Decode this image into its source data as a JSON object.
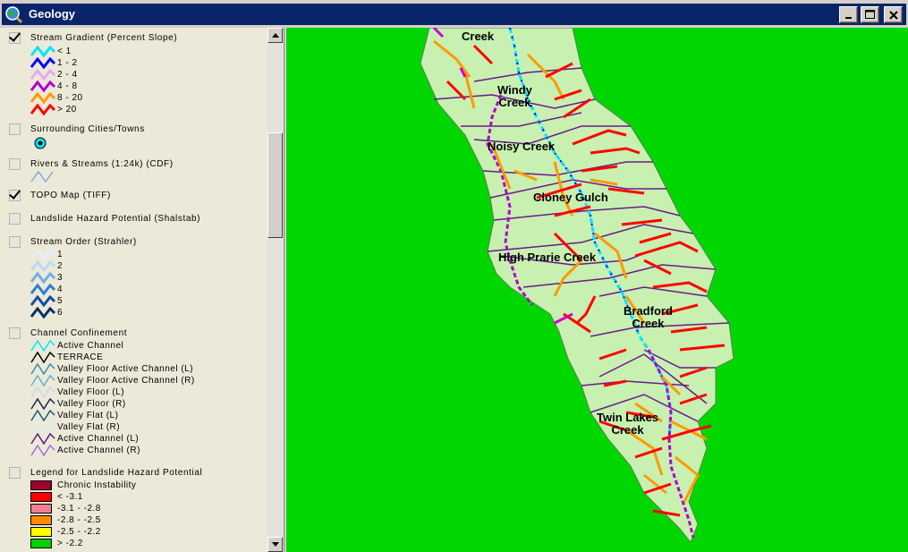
{
  "window": {
    "title": "Geology"
  },
  "toc": {
    "layers": [
      {
        "label": "Stream Gradient (Percent Slope)",
        "checked": true,
        "legend": [
          {
            "label": "< 1",
            "color": "#00e5ff"
          },
          {
            "label": "1 - 2",
            "color": "#0000ff"
          },
          {
            "label": "2 - 4",
            "color": "#e8a8f0"
          },
          {
            "label": "4 - 8",
            "color": "#b000d0"
          },
          {
            "label": "8 - 20",
            "color": "#ff9900"
          },
          {
            "label": "> 20",
            "color": "#ff0000"
          }
        ]
      },
      {
        "label": "Surrounding Cities/Towns",
        "checked": false
      },
      {
        "label": "Rivers & Streams (1:24k) (CDF)",
        "checked": false
      },
      {
        "label": "TOPO Map (TIFF)",
        "checked": true
      },
      {
        "label": "Landslide Hazard Potential (Shalstab)",
        "checked": false
      },
      {
        "label": "Stream Order (Strahler)",
        "checked": false,
        "legend": [
          {
            "label": "1",
            "color": "#e6eef8"
          },
          {
            "label": "2",
            "color": "#bcd8f0"
          },
          {
            "label": "3",
            "color": "#6fb0e8"
          },
          {
            "label": "4",
            "color": "#2a7fd4"
          },
          {
            "label": "5",
            "color": "#1050a0"
          },
          {
            "label": "6",
            "color": "#08306b"
          }
        ]
      },
      {
        "label": "Channel Confinement",
        "checked": false,
        "legend": [
          {
            "label": "Active Channel",
            "color": "#00e5ff"
          },
          {
            "label": "TERRACE",
            "color": "#000000"
          },
          {
            "label": "Valley Floor Active Channel (L)",
            "color": "#3a8fa8"
          },
          {
            "label": "Valley Floor Active Channel (R)",
            "color": "#5ab0e0"
          },
          {
            "label": "Valley Floor (L)",
            "color": "#c8d8f0"
          },
          {
            "label": "Valley Floor (R)",
            "color": "#202050"
          },
          {
            "label": "Valley Flat (L)",
            "color": "#1a5a7a"
          },
          {
            "label": "Valley Flat (R)",
            "color": "#d8f0f8"
          },
          {
            "label": "Active Channel (L)",
            "color": "#5a1a8a"
          },
          {
            "label": "Active Channel (R)",
            "color": "#a070d8"
          }
        ]
      },
      {
        "label": "Legend for Landslide Hazard Potential",
        "checked": false,
        "legend": [
          {
            "label": "Chronic Instability",
            "color": "#a00030"
          },
          {
            "label": "<  -3.1",
            "color": "#ff0000"
          },
          {
            "label": "-3.1 - -2.8",
            "color": "#f08090"
          },
          {
            "label": "-2.8 - -2.5",
            "color": "#ff8c00"
          },
          {
            "label": "-2.5 - -2.2",
            "color": "#ffff00"
          },
          {
            "label": "> -2.2",
            "color": "#00d000"
          }
        ]
      }
    ]
  },
  "map": {
    "background": "#00d600",
    "basin_fill": "#c8f0b0",
    "watershed_labels": [
      "Creek",
      "Windy\nCreek",
      "Noisy Creek",
      "Cloney Gulch",
      "High Prarie Creek",
      "Bradford\nCreek",
      "Twin Lakes\nCreek"
    ]
  }
}
